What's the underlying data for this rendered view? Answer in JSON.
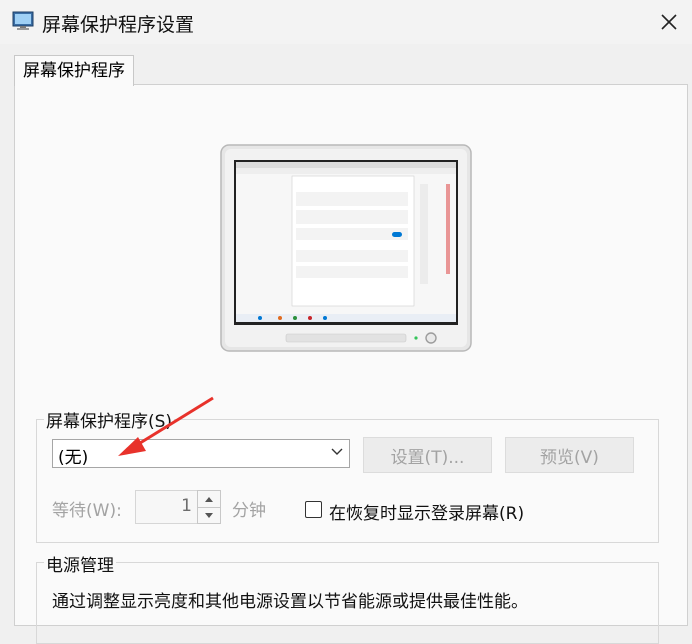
{
  "window": {
    "title": "屏幕保护程序设置",
    "tab_label": "屏幕保护程序"
  },
  "screensaver": {
    "group_label": "屏幕保护程序(S)",
    "selected": "(无)",
    "settings_button": "设置(T)...",
    "preview_button": "预览(V)",
    "wait_label": "等待(W):",
    "wait_value": "1",
    "wait_unit": "分钟",
    "resume_checkbox_label": "在恢复时显示登录屏幕(R)",
    "resume_checked": false
  },
  "power": {
    "group_label": "电源管理",
    "description": "通过调整显示亮度和其他电源设置以节省能源或提供最佳性能。"
  },
  "colors": {
    "accent": "#0078d4",
    "annotation_arrow": "#e8322b",
    "disabled_text": "#a3a3a3"
  },
  "icons": {
    "app": "display-settings-icon",
    "close": "close-icon",
    "dropdown": "chevron-down-icon"
  }
}
